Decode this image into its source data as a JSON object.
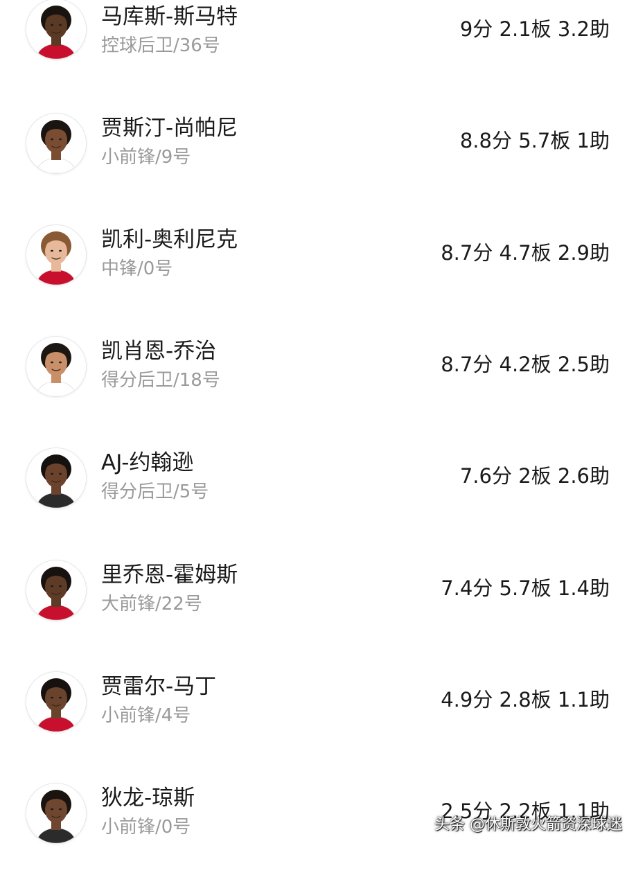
{
  "players": [
    {
      "name": "马库斯-斯马特",
      "position": "控球后卫/36号",
      "stats": "9分 2.1板 3.2助",
      "avatar": "player-headshot-icon",
      "skin": "#5a3a24",
      "hair": "#1a1410",
      "jersey": "#c8102e"
    },
    {
      "name": "贾斯汀-尚帕尼",
      "position": "小前锋/9号",
      "stats": "8.8分 5.7板 1助",
      "avatar": "player-headshot-icon",
      "skin": "#7a4d33",
      "hair": "#1b1512",
      "jersey": "#ffffff"
    },
    {
      "name": "凯利-奥利尼克",
      "position": "中锋/0号",
      "stats": "8.7分 4.7板 2.9助",
      "avatar": "player-headshot-icon",
      "skin": "#e8b89a",
      "hair": "#8a5a35",
      "jersey": "#c8102e"
    },
    {
      "name": "凯肖恩-乔治",
      "position": "得分后卫/18号",
      "stats": "8.7分 4.2板 2.5助",
      "avatar": "player-headshot-icon",
      "skin": "#c98f68",
      "hair": "#1d1713",
      "jersey": "#ffffff"
    },
    {
      "name": "AJ-约翰逊",
      "position": "得分后卫/5号",
      "stats": "7.6分 2板 2.6助",
      "avatar": "player-headshot-icon",
      "skin": "#6b432c",
      "hair": "#15110e",
      "jersey": "#2b2b2b"
    },
    {
      "name": "里乔恩-霍姆斯",
      "position": "大前锋/22号",
      "stats": "7.4分 5.7板 1.4助",
      "avatar": "player-headshot-icon",
      "skin": "#5e3b27",
      "hair": "#17120f",
      "jersey": "#c8102e"
    },
    {
      "name": "贾雷尔-马丁",
      "position": "小前锋/4号",
      "stats": "4.9分 2.8板 1.1助",
      "avatar": "player-headshot-icon",
      "skin": "#6a432d",
      "hair": "#16110e",
      "jersey": "#c8102e"
    },
    {
      "name": "狄龙-琼斯",
      "position": "小前锋/0号",
      "stats": "2.5分 2.2板 1.1助",
      "avatar": "player-headshot-icon",
      "skin": "#6f462f",
      "hair": "#1a1410",
      "jersey": "#2b2b2b"
    }
  ],
  "watermark": "头条 @休斯敦火箭资深球迷"
}
